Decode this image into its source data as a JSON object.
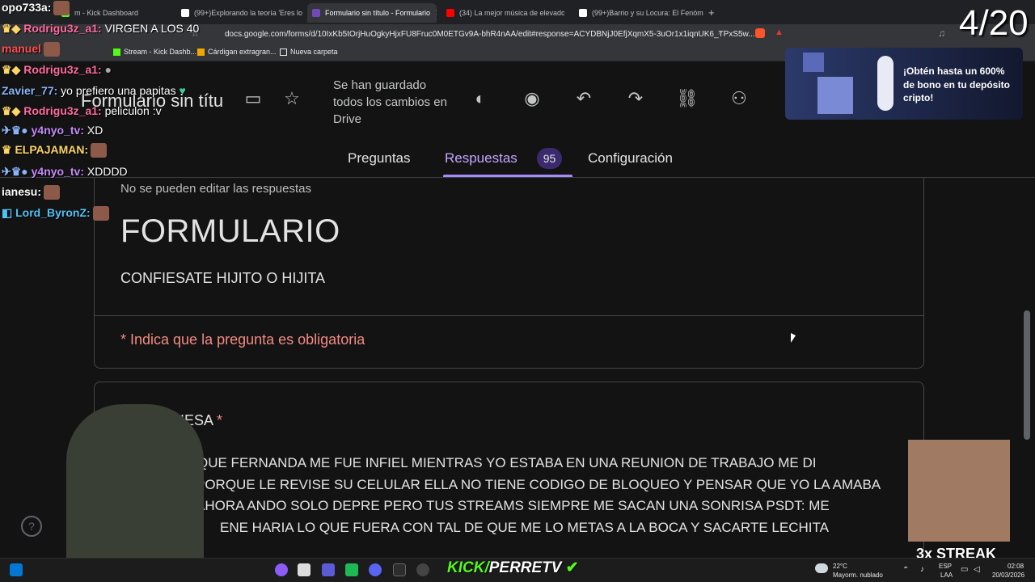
{
  "browser": {
    "tabs": [
      {
        "label": "m - Kick Dashboard",
        "active": false
      },
      {
        "label": "(99+)Explorando la teoría 'Eres lo que",
        "active": false
      },
      {
        "label": "Formulario sin título - Formulario",
        "active": true
      },
      {
        "label": "(34) La mejor música de elevador",
        "active": false
      },
      {
        "label": "(99+)Barrio y su Locura: El Fenómeno",
        "active": false
      }
    ],
    "url": "docs.google.com/forms/d/10IxKb5tOrjHuOgkyHjxFU8Fruc0M0ETGv9A-bhR4nAA/edit#response=ACYDBNjJ0EfjXqmX5-3uOr1x1iqnUK6_TPxS5w...",
    "bookmarks": [
      "Stream - Kick Dashb...",
      "Cárdigan extragran...",
      "Nueva carpeta"
    ]
  },
  "form": {
    "title": "Formulario sin títu",
    "saved_status": "Se han guardado todos los cambios en Drive",
    "tabs": {
      "questions": "Preguntas",
      "responses": "Respuestas",
      "responses_count": "95",
      "settings": "Configuración"
    },
    "no_edit_notice": "No se pueden editar las respuestas",
    "heading": "FORMULARIO",
    "description": "CONFIESATE HIJITO O HIJITA",
    "required_notice": "* Indica que la pregunta es obligatoria",
    "question": {
      "title": "FIESA",
      "required_mark": "*",
      "answer_lines": [
        "QUE FERNANDA ME FUE INFIEL MIENTRAS YO ESTABA EN UNA REUNION DE TRABAJO ME DI",
        "PORQUE LE REVISE SU CELULAR ELLA NO TIENE CODIGO DE BLOQUEO Y PENSAR QUE YO LA AMABA",
        "AHORA ANDO SOLO DEPRE PERO TUS STREAMS SIEMPRE ME SACAN UNA SONRISA PSDT: ME",
        "ENE HARIA LO QUE FUERA CON TAL DE QUE ME LO METAS A LA BOCA Y SACARTE LECHITA"
      ]
    },
    "help_icon": "?"
  },
  "overlay": {
    "chat": [
      {
        "user": "opo733a:",
        "msg": "",
        "color": "#ffffff"
      },
      {
        "user": "Rodrigu3z_a1:",
        "msg": "VIRGEN A LOS 40",
        "color": "#ff6b9e"
      },
      {
        "user": "manuel",
        "msg": "",
        "color": "#ff4d4d"
      },
      {
        "user": "Rodrigu3z_a1:",
        "msg": "",
        "color": "#ff6b9e"
      },
      {
        "user": "Zavier_77:",
        "msg": "yo prefiero una papitas",
        "color": "#8ab4f8"
      },
      {
        "user": "Rodrigu3z_a1:",
        "msg": "peliculon :v",
        "color": "#ff6b9e"
      },
      {
        "user": "y4nyo_tv:",
        "msg": "XD",
        "color": "#c58af9"
      },
      {
        "user": "ELPAJAMAN:",
        "msg": "",
        "color": "#fdd663"
      },
      {
        "user": "y4nyo_tv:",
        "msg": "XDDDD",
        "color": "#c58af9"
      },
      {
        "user": "ianesu:",
        "msg": "",
        "color": "#ffffff"
      },
      {
        "user": "Lord_ByronZ:",
        "msg": "",
        "color": "#4fc3f7"
      }
    ],
    "counter": "4/20",
    "ad_text": "¡Obtén hasta un 600% de bono en tu depósito cripto!",
    "streak": "3x STREAK",
    "kick_brand": "KICK/",
    "kick_channel": "PERRETV"
  },
  "taskbar": {
    "weather_temp": "22°C",
    "weather_desc": "Mayorm. nublado",
    "lang": "ESP",
    "lang_sub": "LAA",
    "time": "02:08",
    "date": "20/03/2026"
  }
}
